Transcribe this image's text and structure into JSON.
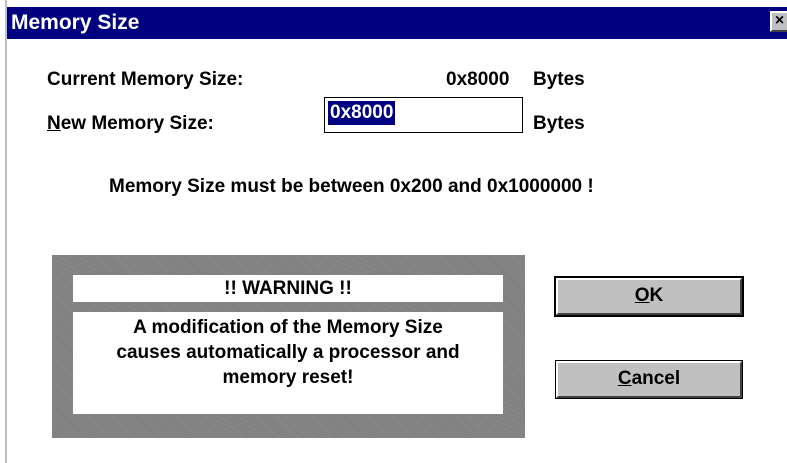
{
  "dialog": {
    "title": "Memory Size",
    "close_glyph": "×",
    "current_size_label": "Current Memory Size:",
    "current_size_value": "0x8000",
    "current_size_unit": "Bytes",
    "new_size_label_mnemonic": "N",
    "new_size_label_rest": "ew Memory Size:",
    "new_size_value": "0x8000",
    "new_size_unit": "Bytes",
    "range_note": "Memory Size must be between 0x200 and 0x1000000 !",
    "warning_title": "!! WARNING !!",
    "warning_line1": "A modification of the Memory Size",
    "warning_line2": "causes automatically a processor and",
    "warning_line3": "memory reset!",
    "ok_mnemonic": "O",
    "ok_rest": "K",
    "cancel_mnemonic": "C",
    "cancel_rest": "ancel"
  },
  "colors": {
    "titlebar": "#000080",
    "button_face": "#c0c0c0",
    "warning_frame": "#808080"
  }
}
